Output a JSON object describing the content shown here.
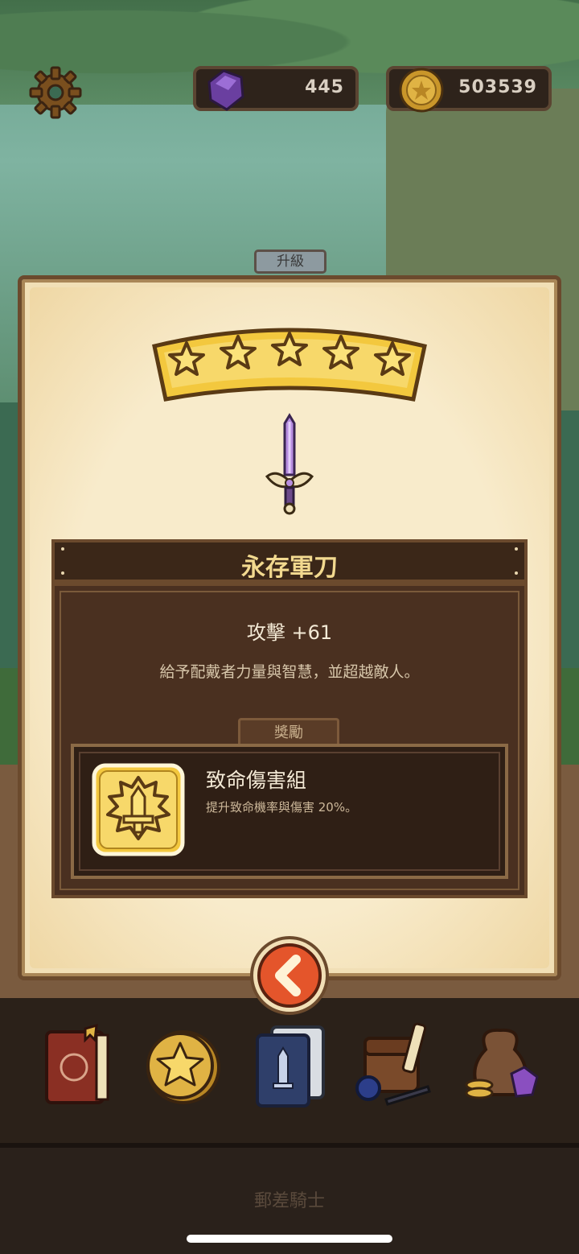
{
  "hud": {
    "gems": "445",
    "coins": "503539"
  },
  "dialog": {
    "tag": "升級",
    "stars": 5,
    "item_name": "永存軍刀",
    "attack": "攻擊 +61",
    "description": "給予配戴者力量與智慧，並超越敵人。",
    "reward_tab": "獎勵",
    "reward_title": "致命傷害組",
    "reward_desc": "提升致命機率與傷害 20%。"
  },
  "footer": {
    "title": "郵差騎士"
  },
  "icons": {
    "settings": "gear-icon",
    "gem": "purple-gem-icon",
    "coin": "gold-coin-icon",
    "back": "chevron-left-icon",
    "nav": [
      "book-icon",
      "star-coin-icon",
      "card-deck-icon",
      "backpack-icon",
      "loot-bag-icon"
    ]
  },
  "colors": {
    "parchment": "#f1dfb6",
    "panel_dark": "#4a3020",
    "gold_text": "#f2d98f",
    "back_button": "#e4552b"
  }
}
